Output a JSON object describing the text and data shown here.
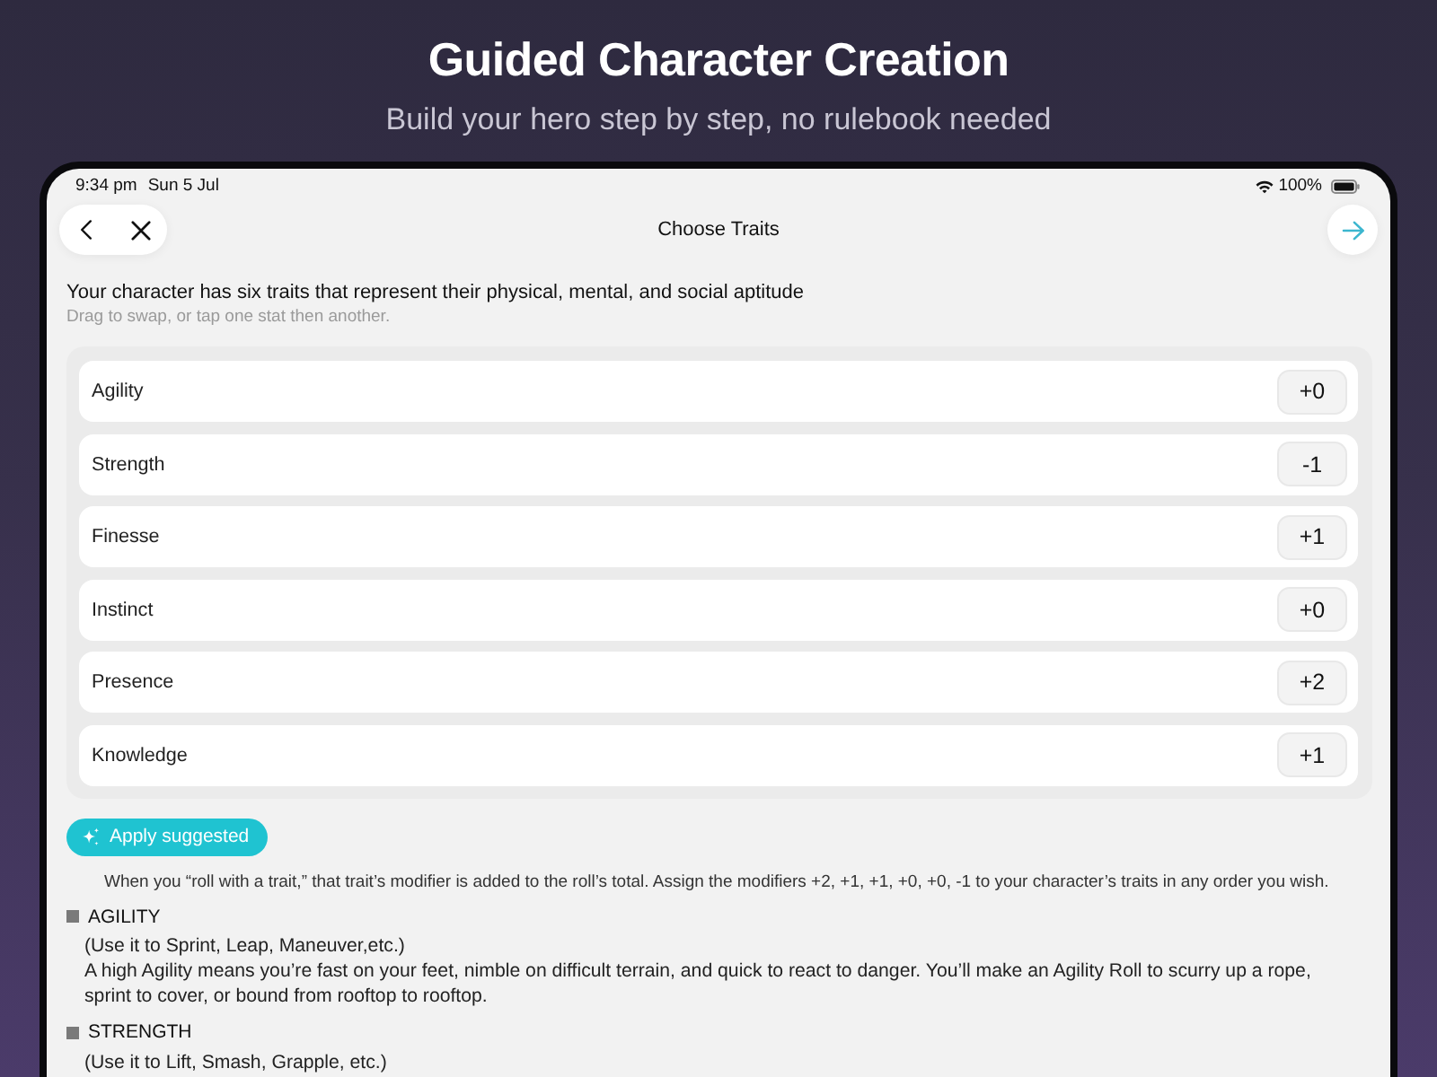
{
  "header": {
    "title": "Guided Character Creation",
    "subtitle": "Build your hero step by step, no rulebook needed"
  },
  "status_bar": {
    "time": "9:34 pm",
    "date": "Sun 5 Jul",
    "battery": "100%"
  },
  "nav": {
    "title": "Choose Traits"
  },
  "intro": {
    "heading": "Your character has six traits that represent their physical, mental, and social aptitude",
    "hint": "Drag to swap, or tap one stat then another."
  },
  "traits": [
    {
      "name": "Agility",
      "modifier": "+0"
    },
    {
      "name": "Strength",
      "modifier": "-1"
    },
    {
      "name": "Finesse",
      "modifier": "+1"
    },
    {
      "name": "Instinct",
      "modifier": "+0"
    },
    {
      "name": "Presence",
      "modifier": "+2"
    },
    {
      "name": "Knowledge",
      "modifier": "+1"
    }
  ],
  "apply_button": {
    "label": "Apply suggested"
  },
  "explanation": "When you “roll with a trait,” that trait’s modifier is added to the roll’s total. Assign the modifiers +2, +1, +1, +0, +0, -1 to your character’s traits in any order you wish.",
  "sections": [
    {
      "title": "AGILITY",
      "usage": "(Use it to Sprint, Leap, Maneuver,etc.)",
      "description": "A high Agility means you’re fast on your feet, nimble on difficult terrain, and quick to react to danger. You’ll make an Agility Roll to scurry up a rope, sprint to cover, or bound from rooftop to rooftop."
    },
    {
      "title": "STRENGTH",
      "usage": "(Use it to Lift, Smash, Grapple, etc.)"
    }
  ]
}
